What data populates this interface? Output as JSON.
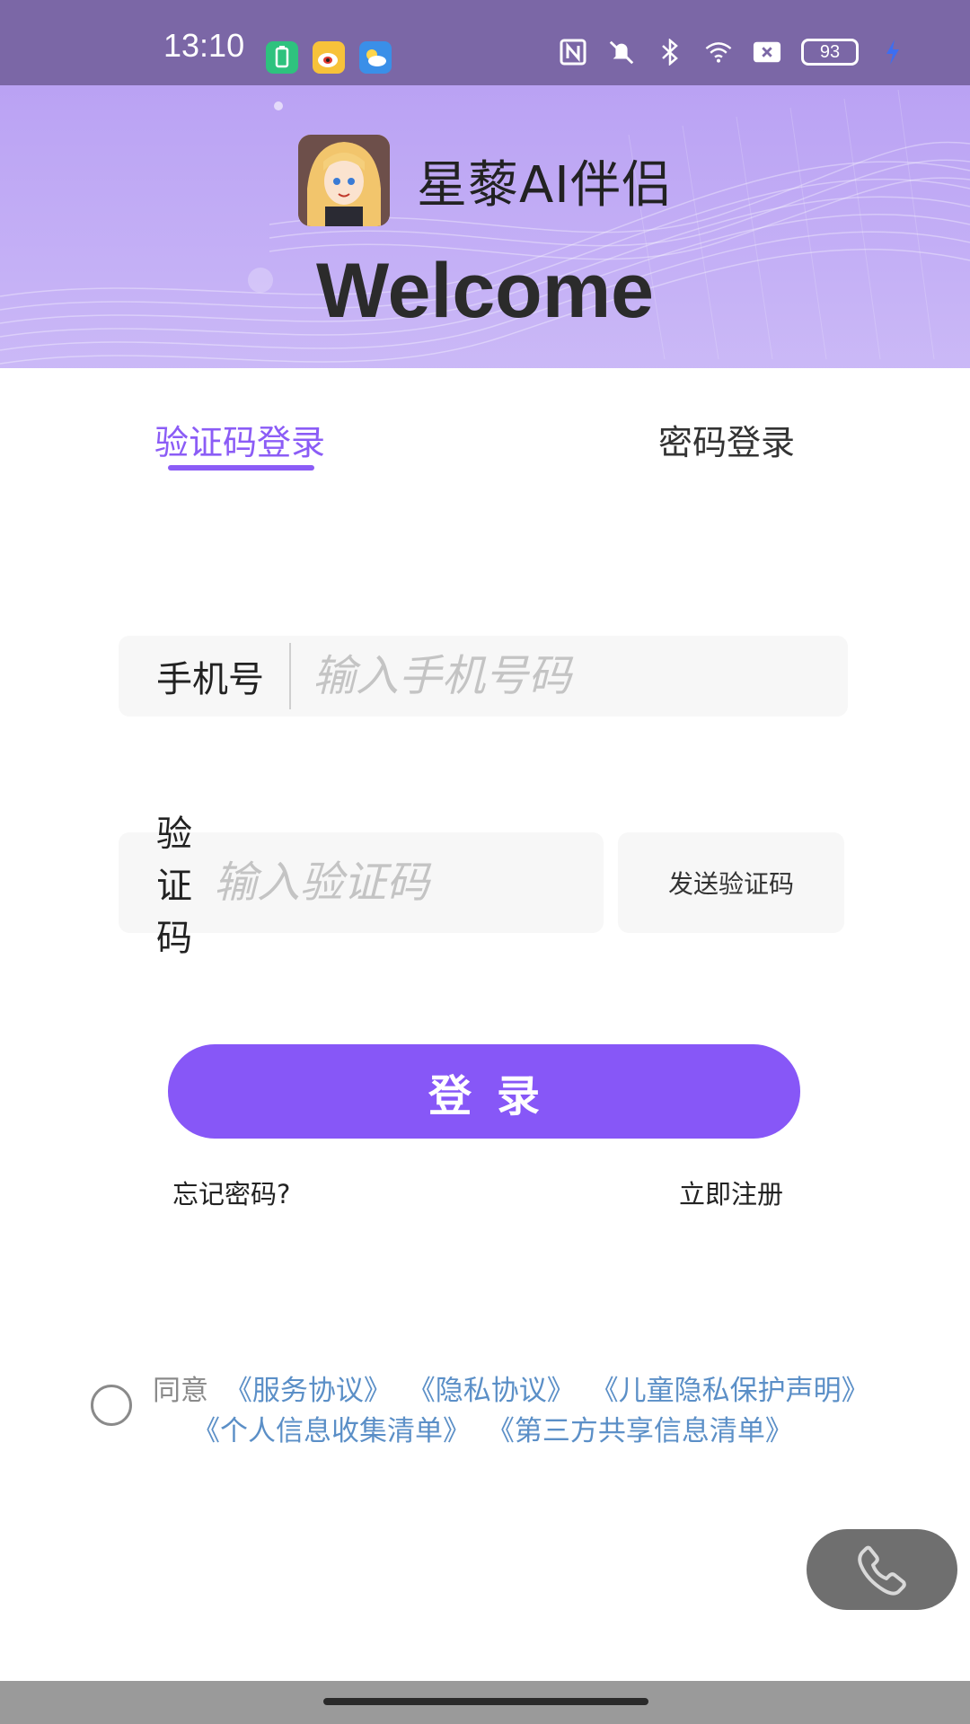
{
  "status_bar": {
    "time": "13:10",
    "battery": "93",
    "icons": [
      "battery-saver-icon",
      "weibo-icon",
      "weather-icon",
      "nfc-icon",
      "mute-icon",
      "bluetooth-icon",
      "wifi-icon",
      "sim-off-icon",
      "charging-icon"
    ]
  },
  "header": {
    "app_name": "星藜AI伴侣",
    "welcome": "Welcome"
  },
  "tabs": [
    {
      "label": "验证码登录",
      "active": true
    },
    {
      "label": "密码登录",
      "active": false
    }
  ],
  "form": {
    "phone_label": "手机号",
    "phone_placeholder": "输入手机号码",
    "code_label": "验证码",
    "code_placeholder": "输入验证码",
    "send_code": "发送验证码"
  },
  "login_button": "登录",
  "links": {
    "forgot": "忘记密码?",
    "register": "立即注册"
  },
  "agreement": {
    "prefix": "同意",
    "docs_line1": [
      "《服务协议》",
      "《隐私协议》",
      "《儿童隐私保护声明》"
    ],
    "docs_line2": [
      "《个人信息收集清单》",
      "《第三方共享信息清单》"
    ]
  },
  "colors": {
    "accent": "#8757f7",
    "link": "#5b8fc7",
    "status_bar": "#7b67a6"
  }
}
